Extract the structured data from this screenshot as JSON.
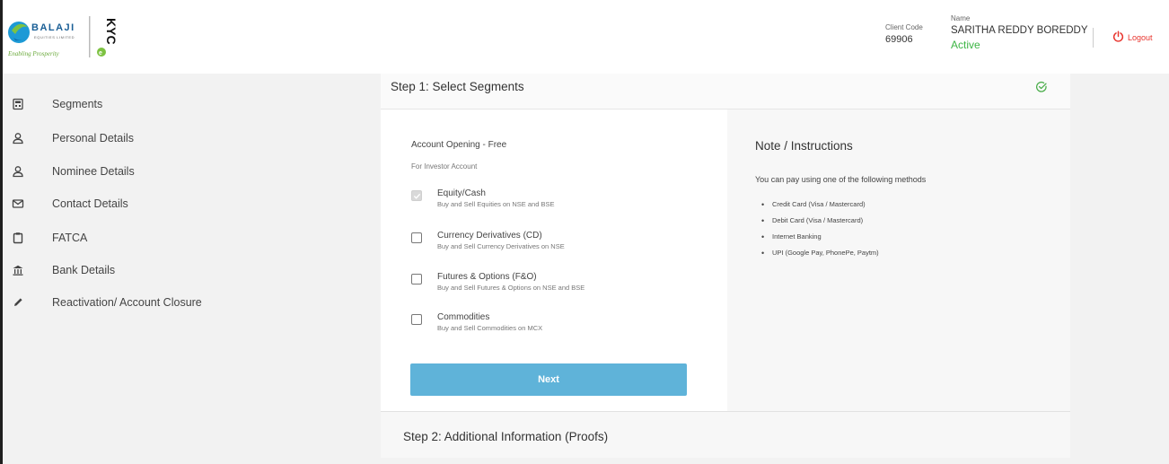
{
  "brand": {
    "name": "BALAJI",
    "subname": "EQUITIES LIMITED",
    "tagline": "Enabling Prosperity",
    "product": "e-KYC"
  },
  "header": {
    "client_code_label": "Client Code",
    "client_code": "69906",
    "name_label": "Name",
    "name": "SARITHA REDDY BOREDDY",
    "status": "Active",
    "logout": "Logout"
  },
  "sidebar": {
    "items": [
      {
        "label": "Segments",
        "icon": "calculator-icon"
      },
      {
        "label": "Personal Details",
        "icon": "user-icon"
      },
      {
        "label": "Nominee Details",
        "icon": "user-icon"
      },
      {
        "label": "Contact Details",
        "icon": "mail-icon"
      },
      {
        "label": "FATCA",
        "icon": "clipboard-icon"
      },
      {
        "label": "Bank Details",
        "icon": "bank-icon"
      },
      {
        "label": "Reactivation/ Account Closure",
        "icon": "pencil-icon"
      }
    ]
  },
  "step1": {
    "title": "Step 1: Select Segments",
    "account_title": "Account Opening - Free",
    "account_sub": "For Investor Account",
    "segments": [
      {
        "name": "Equity/Cash",
        "desc": "Buy and Sell Equities on NSE and BSE",
        "checked": true
      },
      {
        "name": "Currency Derivatives (CD)",
        "desc": "Buy and Sell Currency Derivatives on NSE",
        "checked": false
      },
      {
        "name": "Futures & Options (F&O)",
        "desc": "Buy and Sell Futures & Options on NSE and BSE",
        "checked": false
      },
      {
        "name": "Commodities",
        "desc": "Buy and Sell Commodities on MCX",
        "checked": false
      }
    ],
    "next_label": "Next"
  },
  "note": {
    "title": "Note / Instructions",
    "text": "You can pay using one of the following methods",
    "methods": [
      "Credit Card (Visa / Mastercard)",
      "Debit Card (Visa / Mastercard)",
      "Internet Banking",
      "UPI (Google Pay, PhonePe, Paytm)"
    ]
  },
  "step2": {
    "title": "Step 2: Additional Information (Proofs)"
  },
  "colors": {
    "accent_blue": "#5fb3d9",
    "status_green": "#3cb544",
    "logout_red": "#e8342d"
  }
}
